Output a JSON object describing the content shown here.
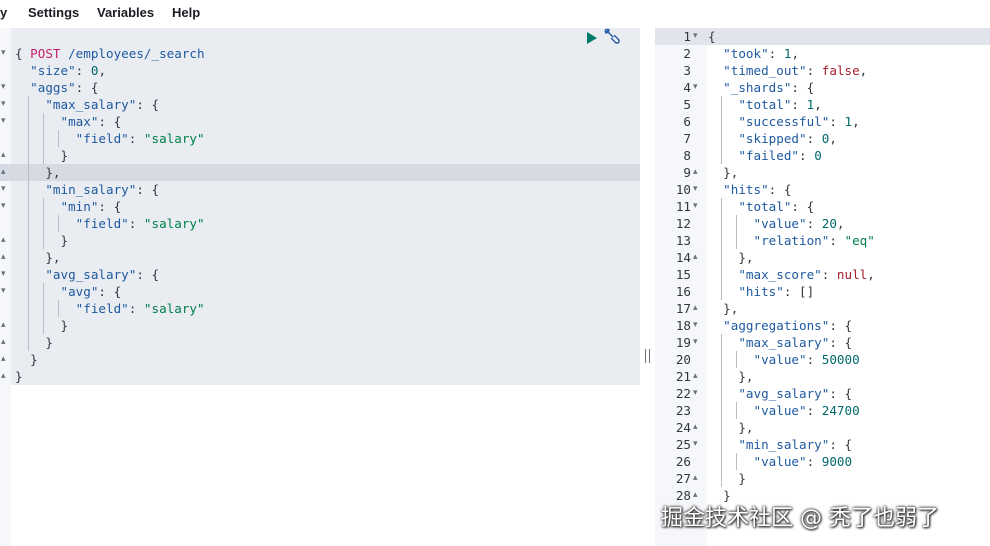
{
  "menu": {
    "items": [
      "y",
      "Settings",
      "Variables",
      "Help"
    ]
  },
  "request": {
    "method": "POST",
    "path": " /employees/_search",
    "lines": [
      [
        [
          "{",
          "plain"
        ]
      ],
      [
        [
          "  ",
          "plain"
        ],
        [
          "\"size\"",
          "key"
        ],
        [
          ": ",
          "plain"
        ],
        [
          "0",
          "num"
        ],
        [
          ",",
          "plain"
        ]
      ],
      [
        [
          "  ",
          "plain"
        ],
        [
          "\"aggs\"",
          "key"
        ],
        [
          ": {",
          "plain"
        ]
      ],
      [
        [
          "    ",
          "plain"
        ],
        [
          "\"max_salary\"",
          "key"
        ],
        [
          ": {",
          "plain"
        ]
      ],
      [
        [
          "      ",
          "plain"
        ],
        [
          "\"max\"",
          "key"
        ],
        [
          ": {",
          "plain"
        ]
      ],
      [
        [
          "        ",
          "plain"
        ],
        [
          "\"field\"",
          "key"
        ],
        [
          ": ",
          "plain"
        ],
        [
          "\"salary\"",
          "str"
        ]
      ],
      [
        [
          "      }",
          "plain"
        ]
      ],
      [
        [
          "    },",
          "plain"
        ]
      ],
      [
        [
          "    ",
          "plain"
        ],
        [
          "\"min_salary\"",
          "key"
        ],
        [
          ": {",
          "plain"
        ]
      ],
      [
        [
          "      ",
          "plain"
        ],
        [
          "\"min\"",
          "key"
        ],
        [
          ": {",
          "plain"
        ]
      ],
      [
        [
          "        ",
          "plain"
        ],
        [
          "\"field\"",
          "key"
        ],
        [
          ": ",
          "plain"
        ],
        [
          "\"salary\"",
          "str"
        ]
      ],
      [
        [
          "      }",
          "plain"
        ]
      ],
      [
        [
          "    },",
          "plain"
        ]
      ],
      [
        [
          "    ",
          "plain"
        ],
        [
          "\"avg_salary\"",
          "key"
        ],
        [
          ": {",
          "plain"
        ]
      ],
      [
        [
          "      ",
          "plain"
        ],
        [
          "\"avg\"",
          "key"
        ],
        [
          ": {",
          "plain"
        ]
      ],
      [
        [
          "        ",
          "plain"
        ],
        [
          "\"field\"",
          "key"
        ],
        [
          ": ",
          "plain"
        ],
        [
          "\"salary\"",
          "str"
        ]
      ],
      [
        [
          "      }",
          "plain"
        ]
      ],
      [
        [
          "    }",
          "plain"
        ]
      ],
      [
        [
          "  }",
          "plain"
        ]
      ],
      [
        [
          "}",
          "plain"
        ]
      ]
    ],
    "folds": [
      "",
      "▾",
      "",
      "▾",
      "▾",
      "▾",
      "",
      "▴",
      "▴",
      "▾",
      "▾",
      "",
      "▴",
      "▴",
      "▾",
      "▾",
      "",
      "▴",
      "▴",
      "▴",
      "▴"
    ]
  },
  "response": {
    "lines": [
      [
        [
          "{",
          "plain"
        ]
      ],
      [
        [
          "  ",
          "plain"
        ],
        [
          "\"took\"",
          "key"
        ],
        [
          ": ",
          "plain"
        ],
        [
          "1",
          "num"
        ],
        [
          ",",
          "plain"
        ]
      ],
      [
        [
          "  ",
          "plain"
        ],
        [
          "\"timed_out\"",
          "key"
        ],
        [
          ": ",
          "plain"
        ],
        [
          "false",
          "bool"
        ],
        [
          ",",
          "plain"
        ]
      ],
      [
        [
          "  ",
          "plain"
        ],
        [
          "\"_shards\"",
          "key"
        ],
        [
          ": {",
          "plain"
        ]
      ],
      [
        [
          "    ",
          "plain"
        ],
        [
          "\"total\"",
          "key"
        ],
        [
          ": ",
          "plain"
        ],
        [
          "1",
          "num"
        ],
        [
          ",",
          "plain"
        ]
      ],
      [
        [
          "    ",
          "plain"
        ],
        [
          "\"successful\"",
          "key"
        ],
        [
          ": ",
          "plain"
        ],
        [
          "1",
          "num"
        ],
        [
          ",",
          "plain"
        ]
      ],
      [
        [
          "    ",
          "plain"
        ],
        [
          "\"skipped\"",
          "key"
        ],
        [
          ": ",
          "plain"
        ],
        [
          "0",
          "num"
        ],
        [
          ",",
          "plain"
        ]
      ],
      [
        [
          "    ",
          "plain"
        ],
        [
          "\"failed\"",
          "key"
        ],
        [
          ": ",
          "plain"
        ],
        [
          "0",
          "num"
        ]
      ],
      [
        [
          "  },",
          "plain"
        ]
      ],
      [
        [
          "  ",
          "plain"
        ],
        [
          "\"hits\"",
          "key"
        ],
        [
          ": {",
          "plain"
        ]
      ],
      [
        [
          "    ",
          "plain"
        ],
        [
          "\"total\"",
          "key"
        ],
        [
          ": {",
          "plain"
        ]
      ],
      [
        [
          "      ",
          "plain"
        ],
        [
          "\"value\"",
          "key"
        ],
        [
          ": ",
          "plain"
        ],
        [
          "20",
          "num"
        ],
        [
          ",",
          "plain"
        ]
      ],
      [
        [
          "      ",
          "plain"
        ],
        [
          "\"relation\"",
          "key"
        ],
        [
          ": ",
          "plain"
        ],
        [
          "\"eq\"",
          "str"
        ]
      ],
      [
        [
          "    },",
          "plain"
        ]
      ],
      [
        [
          "    ",
          "plain"
        ],
        [
          "\"max_score\"",
          "key"
        ],
        [
          ": ",
          "plain"
        ],
        [
          "null",
          "bool"
        ],
        [
          ",",
          "plain"
        ]
      ],
      [
        [
          "    ",
          "plain"
        ],
        [
          "\"hits\"",
          "key"
        ],
        [
          ": []",
          "plain"
        ]
      ],
      [
        [
          "  },",
          "plain"
        ]
      ],
      [
        [
          "  ",
          "plain"
        ],
        [
          "\"aggregations\"",
          "key"
        ],
        [
          ": {",
          "plain"
        ]
      ],
      [
        [
          "    ",
          "plain"
        ],
        [
          "\"max_salary\"",
          "key"
        ],
        [
          ": {",
          "plain"
        ]
      ],
      [
        [
          "      ",
          "plain"
        ],
        [
          "\"value\"",
          "key"
        ],
        [
          ": ",
          "plain"
        ],
        [
          "50000",
          "num"
        ]
      ],
      [
        [
          "    },",
          "plain"
        ]
      ],
      [
        [
          "    ",
          "plain"
        ],
        [
          "\"avg_salary\"",
          "key"
        ],
        [
          ": {",
          "plain"
        ]
      ],
      [
        [
          "      ",
          "plain"
        ],
        [
          "\"value\"",
          "key"
        ],
        [
          ": ",
          "plain"
        ],
        [
          "24700",
          "num"
        ]
      ],
      [
        [
          "    },",
          "plain"
        ]
      ],
      [
        [
          "    ",
          "plain"
        ],
        [
          "\"min_salary\"",
          "key"
        ],
        [
          ": {",
          "plain"
        ]
      ],
      [
        [
          "      ",
          "plain"
        ],
        [
          "\"value\"",
          "key"
        ],
        [
          ": ",
          "plain"
        ],
        [
          "9000",
          "num"
        ]
      ],
      [
        [
          "    }",
          "plain"
        ]
      ],
      [
        [
          "  }",
          "plain"
        ]
      ]
    ],
    "line_numbers": [
      "1",
      "2",
      "3",
      "4",
      "5",
      "6",
      "7",
      "8",
      "9",
      "10",
      "11",
      "12",
      "13",
      "14",
      "15",
      "16",
      "17",
      "18",
      "19",
      "20",
      "21",
      "22",
      "23",
      "24",
      "25",
      "26",
      "27",
      "28"
    ],
    "folds": [
      "▾",
      "",
      "",
      "▾",
      "",
      "",
      "",
      "",
      "▴",
      "▾",
      "▾",
      "",
      "",
      "▴",
      "",
      "",
      "▴",
      "▾",
      "▾",
      "",
      "▴",
      "▾",
      "",
      "▴",
      "▾",
      "",
      "▴",
      "▴"
    ]
  },
  "icons": {
    "run": "play-icon",
    "settings": "wrench-icon"
  },
  "colors": {
    "run": "#00796b",
    "wrench": "#1f5aa0"
  },
  "watermark": "掘金技术社区 @ 秃了也弱了"
}
